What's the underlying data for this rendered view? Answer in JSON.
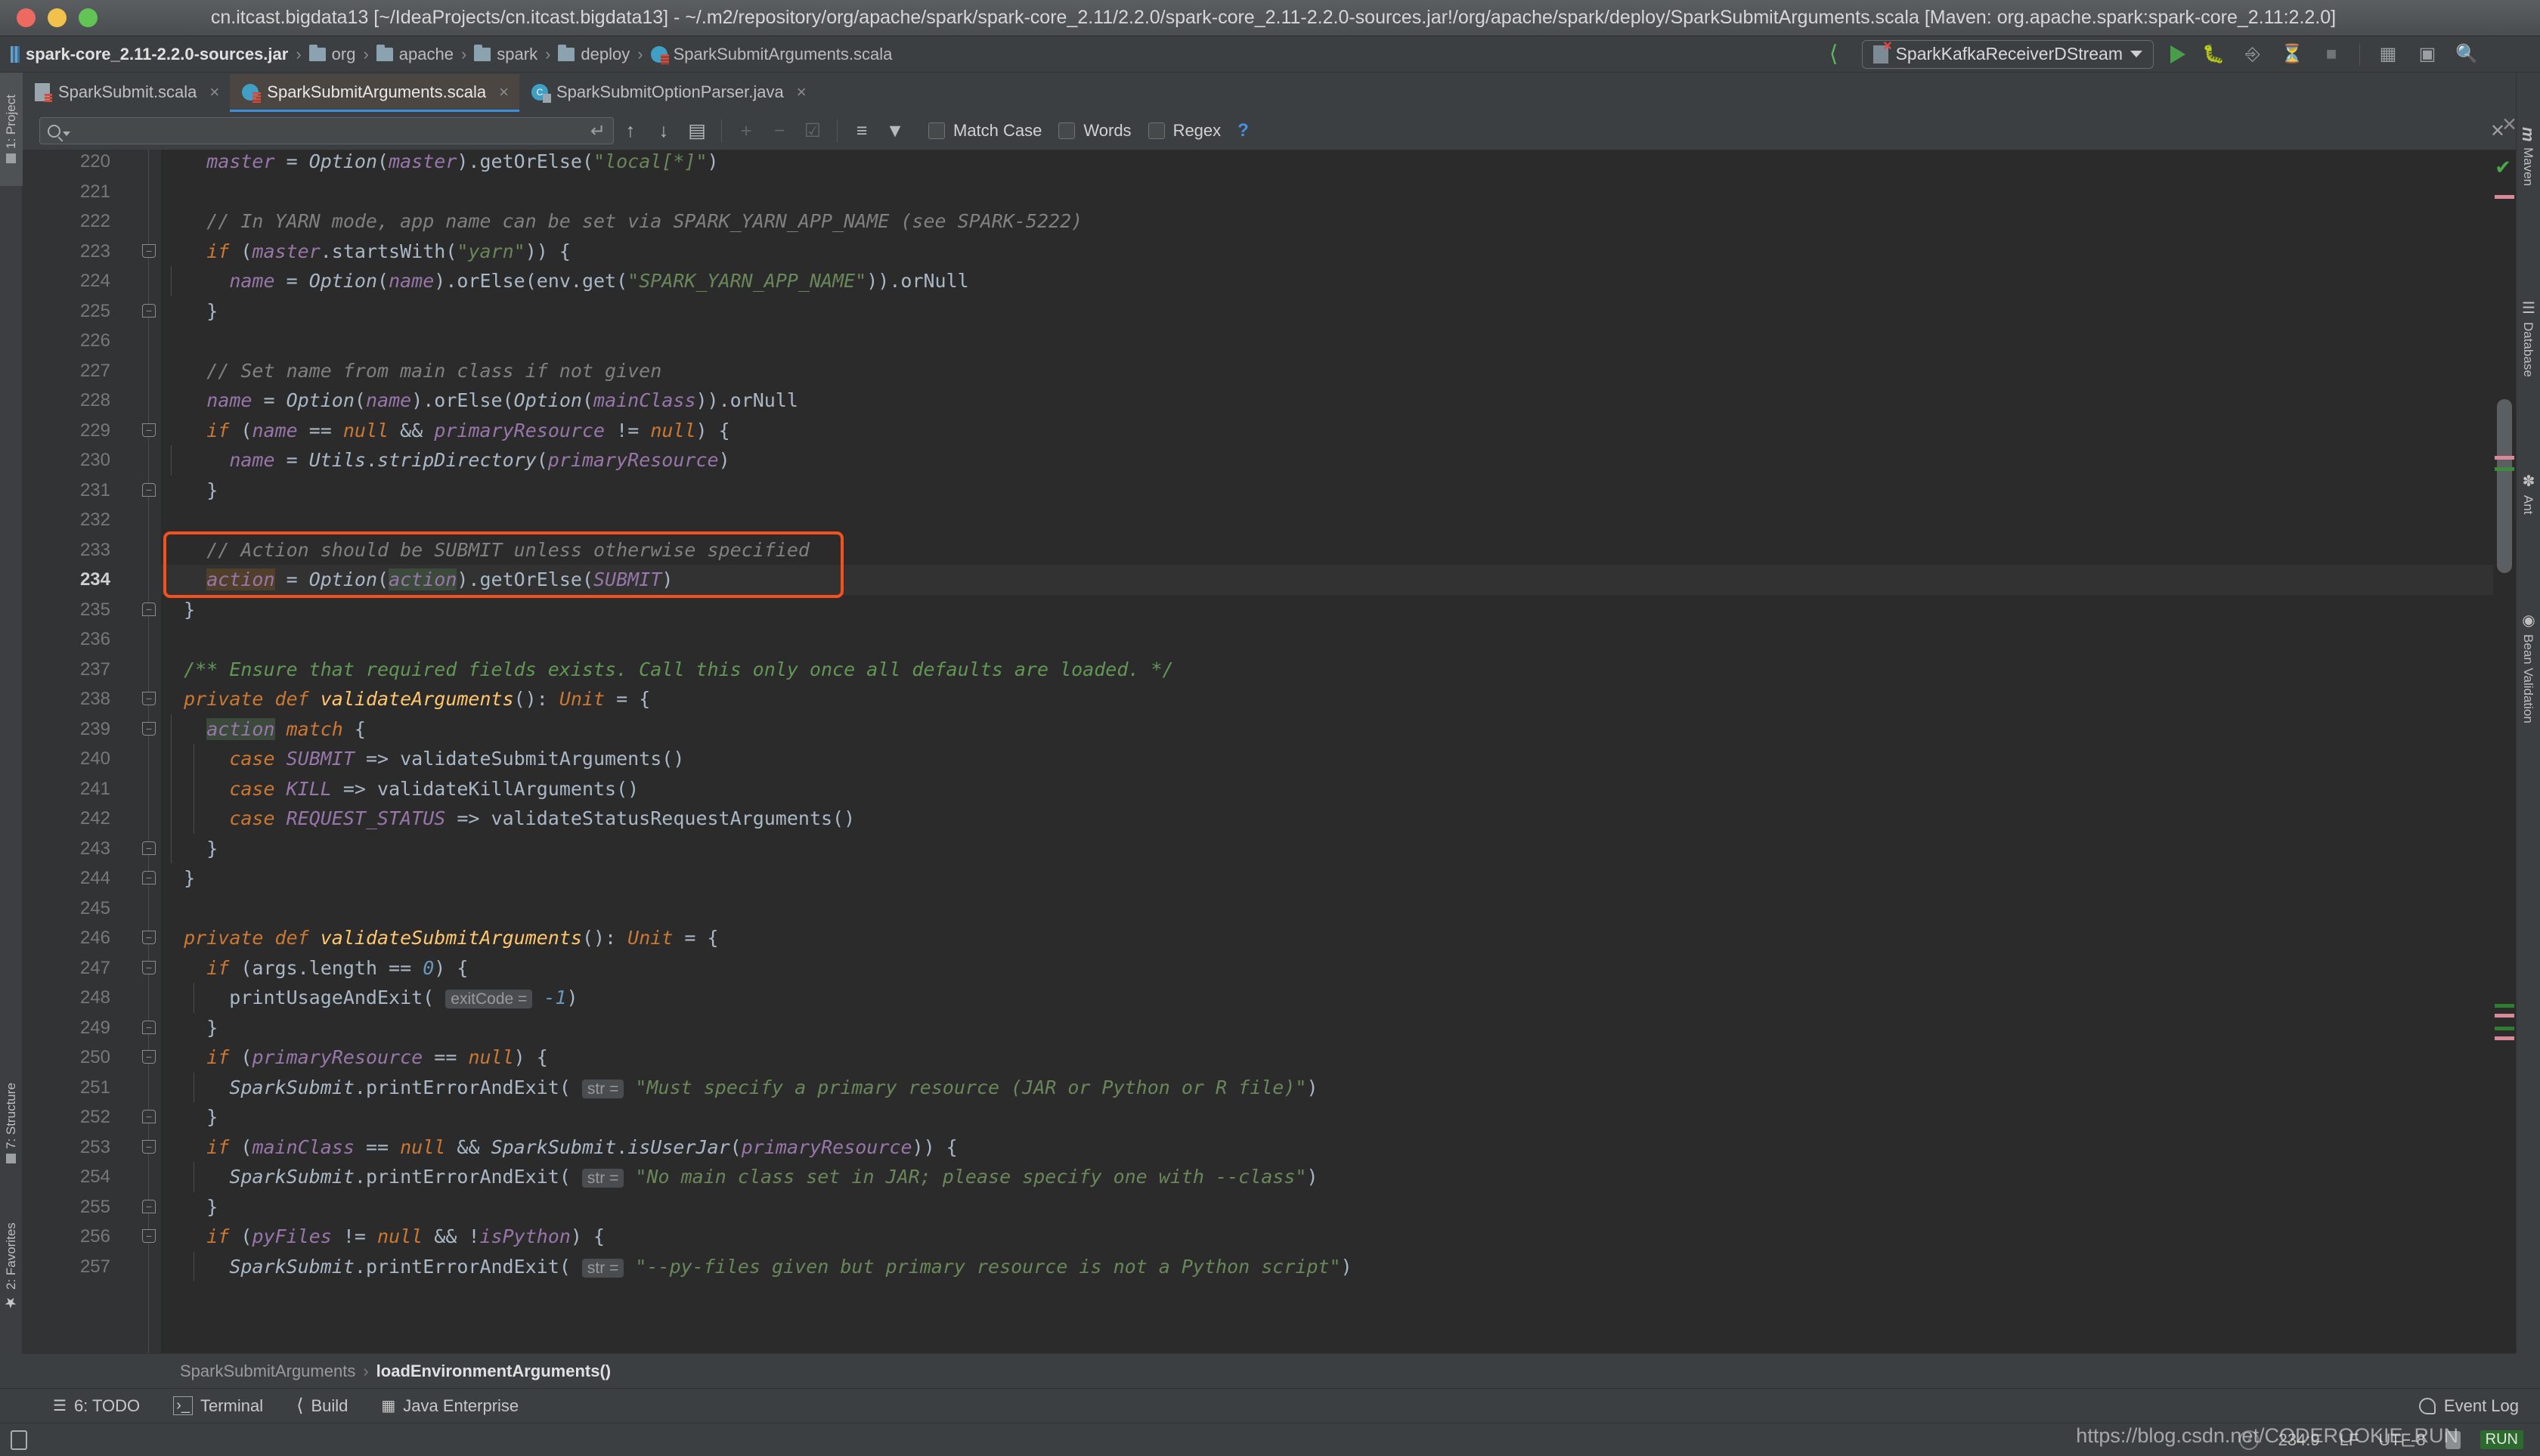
{
  "window": {
    "title": "cn.itcast.bigdata13 [~/IdeaProjects/cn.itcast.bigdata13] - ~/.m2/repository/org/apache/spark/spark-core_2.11/2.2.0/spark-core_2.11-2.2.0-sources.jar!/org/apache/spark/deploy/SparkSubmitArguments.scala [Maven: org.apache.spark:spark-core_2.11:2.2.0]"
  },
  "breadcrumbs": [
    {
      "label": "spark-core_2.11-2.2.0-sources.jar",
      "icon": "jar-icon",
      "bold": true
    },
    {
      "label": "org",
      "icon": "folder-icon",
      "bold": false
    },
    {
      "label": "apache",
      "icon": "folder-icon",
      "bold": false
    },
    {
      "label": "spark",
      "icon": "folder-icon",
      "bold": false
    },
    {
      "label": "deploy",
      "icon": "folder-icon",
      "bold": false
    },
    {
      "label": "SparkSubmitArguments.scala",
      "icon": "scala-file-icon",
      "bold": false
    }
  ],
  "toolbar": {
    "build_icon": "build-hammer-icon",
    "run_configuration": "SparkKafkaReceiverDStream",
    "run_icon": "run-icon",
    "debug_icon": "debug-icon",
    "run_coverage_icon": "run-with-coverage-icon",
    "profile_icon": "profile-icon",
    "stop_icon": "stop-icon",
    "layout_icon": "restore-layout-icon",
    "terminal_icon": "open-terminal-icon",
    "search_everywhere_icon": "search-everywhere-icon"
  },
  "left_tool_window": {
    "items": [
      {
        "label": "1: Project",
        "active": true
      },
      {
        "label": "7: Structure",
        "active": false
      },
      {
        "label": "2: Favorites",
        "active": false
      }
    ]
  },
  "right_tool_window": {
    "items": [
      {
        "label": "Maven",
        "icon": "maven-icon"
      },
      {
        "label": "Database",
        "icon": "database-icon"
      },
      {
        "label": "Ant",
        "icon": "ant-icon"
      },
      {
        "label": "Bean Validation",
        "icon": "bean-validation-icon"
      }
    ]
  },
  "editor_tabs": [
    {
      "label": "SparkSubmit.scala",
      "icon": "scala-object-icon",
      "active": false,
      "close": "×"
    },
    {
      "label": "SparkSubmitArguments.scala",
      "icon": "scala-class-icon",
      "active": true,
      "close": "×"
    },
    {
      "label": "SparkSubmitOptionParser.java",
      "icon": "java-class-icon",
      "active": false,
      "close": "×"
    }
  ],
  "find_toolbar": {
    "search_value": "",
    "search_placeholder": "",
    "search_icon": "search-icon",
    "history_caret_icon": "chevron-down-icon",
    "newline_icon": "new-line-icon",
    "prev_icon": "find-previous-icon",
    "next_icon": "find-next-icon",
    "select_all_icon": "select-all-occurrences-icon",
    "add_icon": "add-occurrence-icon",
    "remove_icon": "remove-occurrence-icon",
    "toggle_icon": "toggle-occurrence-icon",
    "preserve_case_icon": "preserve-case-icon",
    "filter_icon": "filter-icon",
    "close_icon": "close-icon",
    "checkboxes": [
      {
        "label": "Match Case",
        "checked": false
      },
      {
        "label": "Words",
        "checked": false
      },
      {
        "label": "Regex",
        "checked": false
      }
    ],
    "help_label": "?"
  },
  "editor": {
    "caret_line": 234,
    "first_line": 220,
    "code_lines": [
      {
        "n": 220,
        "fold": "",
        "html": "    <i class='fld'>master</i> = <i class='cls'>Option</i>(<i class='fld'>master</i>).getOrElse(<i class='str'>\"local[*]\"</i>)"
      },
      {
        "n": 221,
        "fold": "",
        "html": ""
      },
      {
        "n": 222,
        "fold": "",
        "html": "    <i class='cmt'>// In YARN mode, app name can be set via SPARK_YARN_APP_NAME (see SPARK-5222)</i>"
      },
      {
        "n": 223,
        "fold": "open",
        "html": "    <i class='kw'>if</i> (<i class='fld'>master</i>.startsWith(<i class='str'>\"yarn\"</i>)) {"
      },
      {
        "n": 224,
        "fold": "",
        "html": "      <i class='fld'>name</i> = <i class='cls'>Option</i>(<i class='fld'>name</i>).orElse(env.get(<i class='str'>\"SPARK_YARN_APP_NAME\"</i>)).orNull"
      },
      {
        "n": 225,
        "fold": "close",
        "html": "    }"
      },
      {
        "n": 226,
        "fold": "",
        "html": ""
      },
      {
        "n": 227,
        "fold": "",
        "html": "    <i class='cmt'>// Set name from main class if not given</i>"
      },
      {
        "n": 228,
        "fold": "",
        "html": "    <i class='fld'>name</i> = <i class='cls'>Option</i>(<i class='fld'>name</i>).orElse(<i class='cls'>Option</i>(<i class='fld'>mainClass</i>)).orNull"
      },
      {
        "n": 229,
        "fold": "open",
        "html": "    <i class='kw'>if</i> (<i class='fld'>name</i> == <i class='kw'>null</i> &amp;&amp; <i class='fld'>primaryResource</i> != <i class='kw'>null</i>) {"
      },
      {
        "n": 230,
        "fold": "",
        "html": "      <i class='fld'>name</i> = <i class='cls'>Utils</i>.<i class='ital'>stripDirectory</i>(<i class='fld'>primaryResource</i>)"
      },
      {
        "n": 231,
        "fold": "close",
        "html": "    }"
      },
      {
        "n": 232,
        "fold": "",
        "html": ""
      },
      {
        "n": 233,
        "fold": "",
        "html": "    <i class='cmt'>// Action should be SUBMIT unless otherwise specified</i>"
      },
      {
        "n": 234,
        "fold": "",
        "html": "    <i class='fld hl-write'>action</i> = <i class='cls'>Option</i>(<i class='fld hl-read'>action</i>).getOrElse(<i class='fld'>SUBMIT</i>)"
      },
      {
        "n": 235,
        "fold": "close",
        "html": "  }"
      },
      {
        "n": 236,
        "fold": "",
        "html": ""
      },
      {
        "n": 237,
        "fold": "",
        "html": "  <i class='doc'>/** Ensure that required fields exists. Call this only once all defaults are loaded. */</i>"
      },
      {
        "n": 238,
        "fold": "open",
        "html": "  <i class='kw'>private def</i> <i class='fn'>validateArguments</i>(): <i class='kw'>Unit</i> = {"
      },
      {
        "n": 239,
        "fold": "open",
        "html": "    <i class='fld hl-read'>action</i> <i class='kw'>match</i> {"
      },
      {
        "n": 240,
        "fold": "",
        "html": "      <i class='kw'>case</i> <i class='fld'>SUBMIT</i> =&gt; validateSubmitArguments()"
      },
      {
        "n": 241,
        "fold": "",
        "html": "      <i class='kw'>case</i> <i class='fld'>KILL</i> =&gt; validateKillArguments()"
      },
      {
        "n": 242,
        "fold": "",
        "html": "      <i class='kw'>case</i> <i class='fld'>REQUEST_STATUS</i> =&gt; validateStatusRequestArguments()"
      },
      {
        "n": 243,
        "fold": "close",
        "html": "    }"
      },
      {
        "n": 244,
        "fold": "close",
        "html": "  }"
      },
      {
        "n": 245,
        "fold": "",
        "html": ""
      },
      {
        "n": 246,
        "fold": "open",
        "html": "  <i class='kw'>private def</i> <i class='fn'>validateSubmitArguments</i>(): <i class='kw'>Unit</i> = {"
      },
      {
        "n": 247,
        "fold": "open",
        "html": "    <i class='kw'>if</i> (args.length == <i class='num'>0</i>) {"
      },
      {
        "n": 248,
        "fold": "",
        "html": "      printUsageAndExit( <span class='hint'>exitCode =</span> <i class='num'>-1</i>)"
      },
      {
        "n": 249,
        "fold": "close",
        "html": "    }"
      },
      {
        "n": 250,
        "fold": "open",
        "html": "    <i class='kw'>if</i> (<i class='fld'>primaryResource</i> == <i class='kw'>null</i>) {"
      },
      {
        "n": 251,
        "fold": "",
        "html": "      <i class='cls'>SparkSubmit</i>.printErrorAndExit( <span class='hint'>str =</span> <i class='str'>\"Must specify a primary resource (JAR or Python or R file)\"</i>)"
      },
      {
        "n": 252,
        "fold": "close",
        "html": "    }"
      },
      {
        "n": 253,
        "fold": "open",
        "html": "    <i class='kw'>if</i> (<i class='fld'>mainClass</i> == <i class='kw'>null</i> &amp;&amp; <i class='cls'>SparkSubmit</i>.<i class='ital'>isUserJar</i>(<i class='fld'>primaryResource</i>)) {"
      },
      {
        "n": 254,
        "fold": "",
        "html": "      <i class='cls'>SparkSubmit</i>.printErrorAndExit( <span class='hint'>str =</span> <i class='str'>\"No main class set in JAR; please specify one with --class\"</i>)"
      },
      {
        "n": 255,
        "fold": "close",
        "html": "    }"
      },
      {
        "n": 256,
        "fold": "open",
        "html": "    <i class='kw'>if</i> (<i class='fld'>pyFiles</i> != <i class='kw'>null</i> &amp;&amp; !<i class='fld'>isPython</i>) {"
      },
      {
        "n": 257,
        "fold": "",
        "html": "      <i class='cls'>SparkSubmit</i>.printErrorAndExit( <span class='hint'>str =</span> <i class='str'>\"--py-files given but primary resource is not a Python script\"</i>)"
      }
    ],
    "highlight_box": {
      "from_line": 233,
      "to_line": 234,
      "color": "#f4511e"
    },
    "inspection_status": "ok",
    "breadcrumb": {
      "class": "SparkSubmitArguments",
      "separator": "›",
      "member": "loadEnvironmentArguments()"
    }
  },
  "bottom_tool_windows": [
    {
      "label": "6: TODO",
      "mnemonic": "6",
      "icon": "todo-icon"
    },
    {
      "label": "Terminal",
      "icon": "terminal-icon"
    },
    {
      "label": "Build",
      "icon": "build-icon"
    },
    {
      "label": "Java Enterprise",
      "icon": "java-enterprise-icon"
    }
  ],
  "event_log": {
    "label": "Event Log",
    "icon": "event-log-icon"
  },
  "status_bar": {
    "memory_icon": "memory-indicator-icon",
    "caret_position": "234:9",
    "line_separator": "LF",
    "encoding": "UTF-8",
    "lock_icon": "read-only-lock-icon",
    "run_badge": "RUN",
    "watermark": "https://blog.csdn.net/CODEROOKIE_RUN"
  },
  "colors": {
    "accent_highlight": "#f4511e",
    "tab_active_bg": "#4b4641",
    "tab_underline": "#3b8ee0",
    "editor_bg": "#2b2b2b",
    "chrome_bg": "#3c3f41",
    "run_green": "#4a9e4a"
  }
}
